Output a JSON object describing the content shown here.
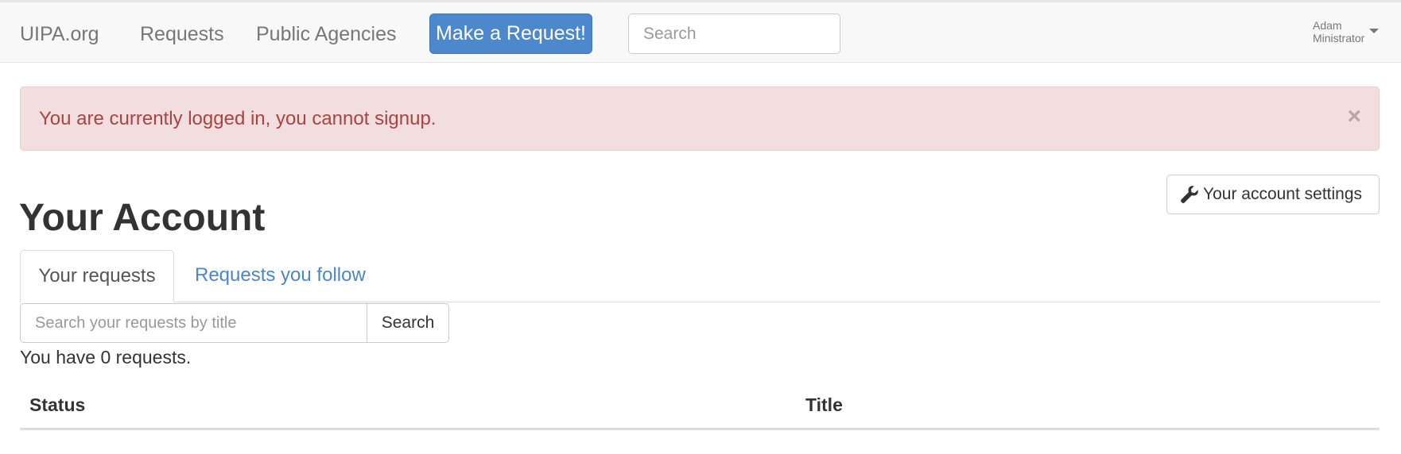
{
  "navbar": {
    "brand": "UIPA.org",
    "links": [
      "Requests",
      "Public Agencies"
    ],
    "cta_label": "Make a Request!",
    "search_placeholder": "Search",
    "user_first": "Adam",
    "user_last": "Ministrator"
  },
  "alert": {
    "message": "You are currently logged in, you cannot signup.",
    "close_glyph": "×"
  },
  "account": {
    "settings_label": "Your account settings",
    "title": "Your Account"
  },
  "tabs": [
    {
      "label": "Your requests",
      "active": true
    },
    {
      "label": "Requests you follow",
      "active": false
    }
  ],
  "request_search": {
    "placeholder": "Search your requests by title",
    "button_label": "Search"
  },
  "summary": "You have 0 requests.",
  "table": {
    "columns": [
      "Status",
      "Title"
    ]
  },
  "icons": {
    "settings": "wrench-icon",
    "close": "close-icon",
    "dropdown": "caret-down-icon"
  },
  "colors": {
    "primary": "#4e88cc",
    "link": "#4a86c8",
    "alert_bg": "#f2dede",
    "alert_text": "#a94442"
  }
}
